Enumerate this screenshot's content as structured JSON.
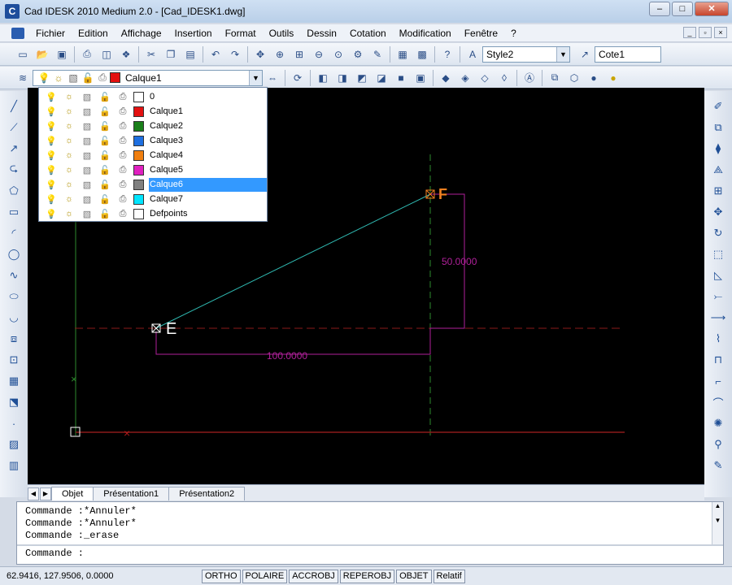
{
  "window": {
    "title": "Cad IDESK 2010 Medium 2.0 - [Cad_IDESK1.dwg]",
    "app_icon": "cad-app-icon",
    "minimize": "–",
    "maximize": "□",
    "close": "✕"
  },
  "menu": {
    "items": [
      "Fichier",
      "Edition",
      "Affichage",
      "Insertion",
      "Format",
      "Outils",
      "Dessin",
      "Cotation",
      "Modification",
      "Fenêtre",
      "?"
    ],
    "doc_min": "_",
    "doc_restore": "▫",
    "doc_close": "×"
  },
  "toolbar1": {
    "style_value": "Style2",
    "dim_style_value": "Cote1"
  },
  "toolbar2": {
    "current_layer": "Calque1",
    "current_layer_color": "#e31010"
  },
  "layers": [
    {
      "name": "0",
      "color": "#ffffff"
    },
    {
      "name": "Calque1",
      "color": "#e31010"
    },
    {
      "name": "Calque2",
      "color": "#1a7f1a"
    },
    {
      "name": "Calque3",
      "color": "#1e6fe0"
    },
    {
      "name": "Calque4",
      "color": "#f07f10"
    },
    {
      "name": "Calque5",
      "color": "#e020c0"
    },
    {
      "name": "Calque6",
      "color": "#808080"
    },
    {
      "name": "Calque7",
      "color": "#00e5ff"
    },
    {
      "name": "Defpoints",
      "color": "#ffffff"
    }
  ],
  "selected_layer": "Calque6",
  "drawing": {
    "point_e_label": "E",
    "point_f_label": "F",
    "dim_horizontal": "100.0000",
    "dim_vertical": "50.0000",
    "colors": {
      "line_ef": "#2fb8b0",
      "dimension": "#b0209a",
      "center_line": "#2e8a2e",
      "dashed_red": "#8a1a1a",
      "point_label": "#ffffff",
      "f_label": "#f08020"
    }
  },
  "tabs": {
    "model": "Objet",
    "layout1": "Présentation1",
    "layout2": "Présentation2"
  },
  "command": {
    "lines": [
      "Commande :*Annuler*",
      "Commande :*Annuler*",
      "Commande :_erase"
    ],
    "prompt": "Commande :"
  },
  "status": {
    "coords": "62.9416, 127.9506, 0.0000",
    "toggles": [
      "ORTHO",
      "POLAIRE",
      "ACCROBJ",
      "REPEROBJ",
      "OBJET",
      "Relatif"
    ]
  }
}
